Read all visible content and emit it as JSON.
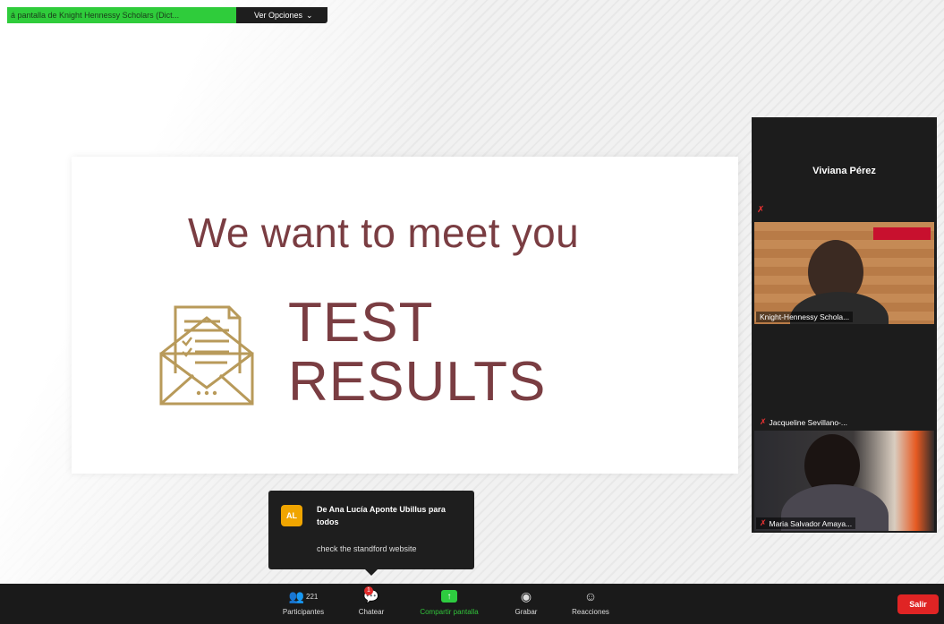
{
  "top_bar": {
    "sharing_text": "á pantalla de Knight Hennessy Scholars (Dict...",
    "options_label": "Ver Opciones",
    "options_icon": "chevron-down-icon"
  },
  "slide": {
    "title": "We want to meet you",
    "big_line1": "TEST",
    "big_line2": "RESULTS",
    "title_color": "#7a3d42",
    "icon": "envelope-document-icon",
    "icon_color": "#b89a5a"
  },
  "panel": {
    "speaker_name": "Viviana Pérez",
    "tiles": [
      {
        "label": "Knight-Hennessy Schola...",
        "muted": false
      },
      {
        "label": "Jacqueline Sevillano-...",
        "muted": true
      },
      {
        "label": "Maria Salvador Amaya...",
        "muted": true
      }
    ]
  },
  "chat_toast": {
    "avatar_initials": "AL",
    "from": "De Ana Lucía Aponte Ubillus para todos",
    "message": "check the standford website"
  },
  "toolbar": {
    "participants_label": "Participantes",
    "participants_count": "221",
    "chat_label": "Chatear",
    "chat_badge": "1",
    "share_label": "Compartir pantalla",
    "record_label": "Grabar",
    "reactions_label": "Reacciones",
    "leave_label": "Salir",
    "share_color": "#2ecc40",
    "leave_color": "#e02424"
  }
}
